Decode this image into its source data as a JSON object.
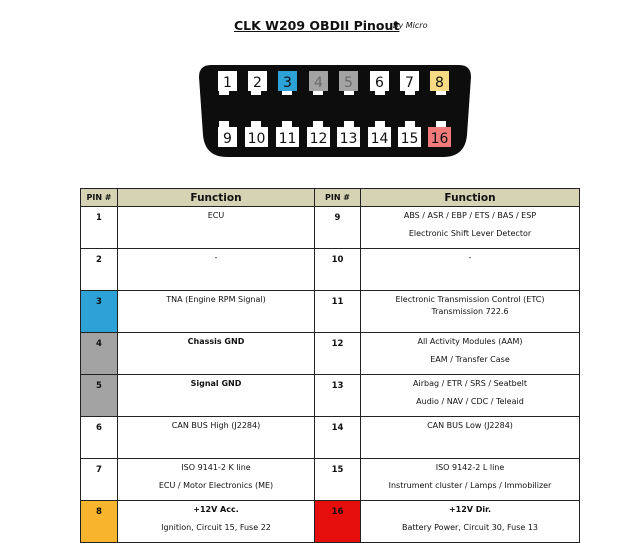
{
  "title": "CLK W209 OBDII Pinout",
  "byline": "By Micro",
  "colors": {
    "blue": "#2da2d6",
    "gray": "#a3a3a3",
    "orange": "#f7b42c",
    "red": "#e60d0d",
    "lightyellow": "#f6db84",
    "lightpink": "#f17b7b",
    "header": "#d6d3b5"
  },
  "connector": {
    "top_pins": [
      "1",
      "2",
      "3",
      "4",
      "5",
      "6",
      "7",
      "8"
    ],
    "bottom_pins": [
      "9",
      "10",
      "11",
      "12",
      "13",
      "14",
      "15",
      "16"
    ]
  },
  "table": {
    "headers": [
      "PIN #",
      "Function",
      "PIN #",
      "Function"
    ],
    "rows": [
      {
        "left_pin": "1",
        "left_func": [
          "ECU"
        ],
        "right_pin": "9",
        "right_func": [
          "ABS / ASR / EBP / ETS / BAS / ESP",
          "Electronic Shift Lever Detector"
        ]
      },
      {
        "left_pin": "2",
        "left_func": [
          "-"
        ],
        "right_pin": "10",
        "right_func": [
          "-"
        ]
      },
      {
        "left_pin": "3",
        "left_func": [
          "TNA (Engine RPM Signal)"
        ],
        "right_pin": "11",
        "right_func": [
          "Electronic Transmission Control (ETC)",
          "Transmission 722.6"
        ]
      },
      {
        "left_pin": "4",
        "left_func": [
          "Chassis GND"
        ],
        "right_pin": "12",
        "right_func": [
          "All Activity Modules (AAM)",
          "EAM / Transfer Case"
        ]
      },
      {
        "left_pin": "5",
        "left_func": [
          "Signal GND"
        ],
        "right_pin": "13",
        "right_func": [
          "Airbag / ETR / SRS / Seatbelt",
          "Audio / NAV / CDC / Teleaid"
        ]
      },
      {
        "left_pin": "6",
        "left_func": [
          "CAN BUS High (J2284)"
        ],
        "right_pin": "14",
        "right_func": [
          "CAN BUS Low (J2284)"
        ]
      },
      {
        "left_pin": "7",
        "left_func": [
          "ISO 9141-2  K line",
          "ECU / Motor Electronics (ME)"
        ],
        "right_pin": "15",
        "right_func": [
          "ISO 9142-2  L line",
          "Instrument cluster / Lamps / Immobilizer"
        ]
      },
      {
        "left_pin": "8",
        "left_func": [
          "+12V Acc.",
          "Ignition, Circuit 15, Fuse 22"
        ],
        "right_pin": "16",
        "right_func": [
          "+12V Dir.",
          "Battery Power, Circuit 30, Fuse 13"
        ]
      }
    ]
  }
}
